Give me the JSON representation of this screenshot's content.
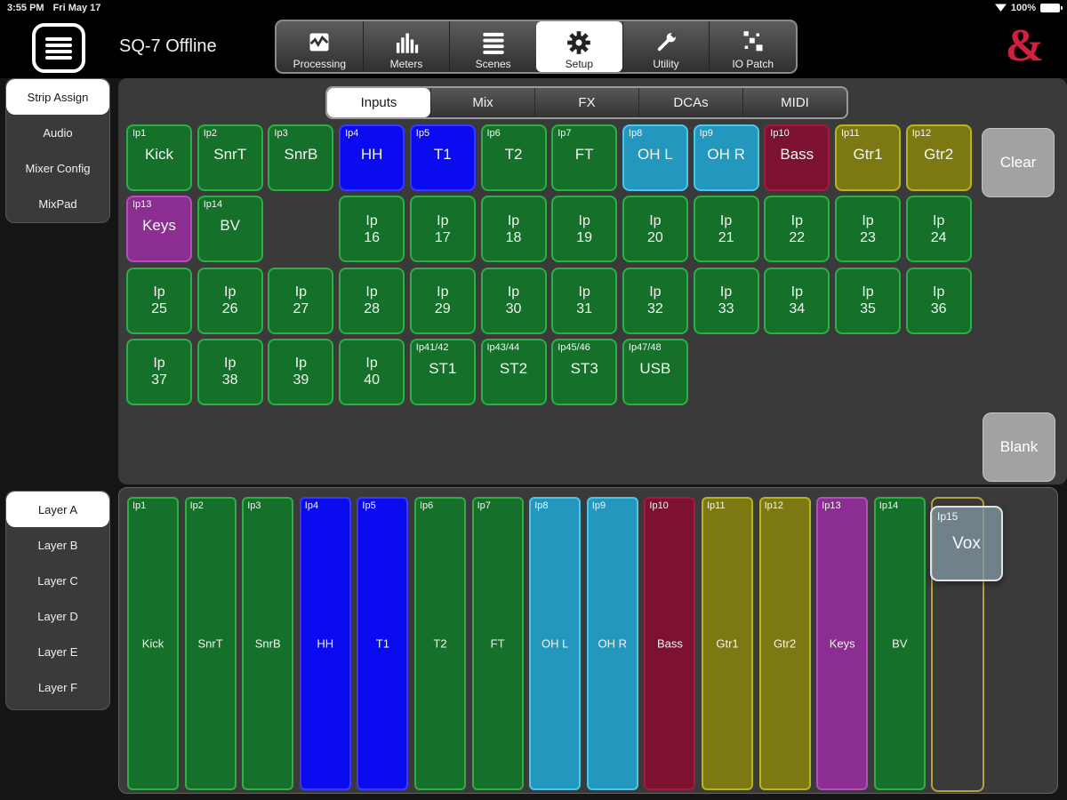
{
  "status_bar": {
    "time": "3:55 PM",
    "date": "Fri May 17",
    "battery": "100%"
  },
  "header": {
    "title": "SQ-7 Offline",
    "logo": "&"
  },
  "nav": {
    "items": [
      {
        "label": "Processing",
        "icon": "processing-icon",
        "selected": false
      },
      {
        "label": "Meters",
        "icon": "meters-icon",
        "selected": false
      },
      {
        "label": "Scenes",
        "icon": "scenes-icon",
        "selected": false
      },
      {
        "label": "Setup",
        "icon": "gear-icon",
        "selected": true
      },
      {
        "label": "Utility",
        "icon": "wrench-icon",
        "selected": false
      },
      {
        "label": "IO Patch",
        "icon": "io-patch-icon",
        "selected": false
      }
    ]
  },
  "sidebar_top": {
    "items": [
      {
        "label": "Strip Assign",
        "selected": true
      },
      {
        "label": "Audio",
        "selected": false
      },
      {
        "label": "Mixer Config",
        "selected": false
      },
      {
        "label": "MixPad",
        "selected": false
      }
    ]
  },
  "tabs": {
    "items": [
      {
        "label": "Inputs",
        "selected": true
      },
      {
        "label": "Mix",
        "selected": false
      },
      {
        "label": "FX",
        "selected": false
      },
      {
        "label": "DCAs",
        "selected": false
      },
      {
        "label": "MIDI",
        "selected": false
      }
    ]
  },
  "channel_grid": {
    "clear_label": "Clear",
    "blank_label": "Blank",
    "buttons": [
      {
        "corner": "Ip1",
        "name": "Kick",
        "color": "green",
        "row": 1,
        "col": 1
      },
      {
        "corner": "Ip2",
        "name": "SnrT",
        "color": "green",
        "row": 1,
        "col": 2
      },
      {
        "corner": "Ip3",
        "name": "SnrB",
        "color": "green",
        "row": 1,
        "col": 3
      },
      {
        "corner": "Ip4",
        "name": "HH",
        "color": "blue",
        "row": 1,
        "col": 4
      },
      {
        "corner": "Ip5",
        "name": "T1",
        "color": "blue",
        "row": 1,
        "col": 5
      },
      {
        "corner": "Ip6",
        "name": "T2",
        "color": "green",
        "row": 1,
        "col": 6
      },
      {
        "corner": "Ip7",
        "name": "FT",
        "color": "green",
        "row": 1,
        "col": 7
      },
      {
        "corner": "Ip8",
        "name": "OH L",
        "color": "cyan",
        "row": 1,
        "col": 8
      },
      {
        "corner": "Ip9",
        "name": "OH R",
        "color": "cyan",
        "row": 1,
        "col": 9
      },
      {
        "corner": "Ip10",
        "name": "Bass",
        "color": "maroon",
        "row": 1,
        "col": 10
      },
      {
        "corner": "Ip11",
        "name": "Gtr1",
        "color": "olive",
        "row": 1,
        "col": 11
      },
      {
        "corner": "Ip12",
        "name": "Gtr2",
        "color": "olive",
        "row": 1,
        "col": 12
      },
      {
        "corner": "Ip13",
        "name": "Keys",
        "color": "purple",
        "row": 2,
        "col": 1
      },
      {
        "corner": "Ip14",
        "name": "BV",
        "color": "green",
        "row": 2,
        "col": 2
      },
      {
        "lines": [
          "Ip",
          "16"
        ],
        "color": "green",
        "row": 2,
        "col": 4
      },
      {
        "lines": [
          "Ip",
          "17"
        ],
        "color": "green",
        "row": 2,
        "col": 5
      },
      {
        "lines": [
          "Ip",
          "18"
        ],
        "color": "green",
        "row": 2,
        "col": 6
      },
      {
        "lines": [
          "Ip",
          "19"
        ],
        "color": "green",
        "row": 2,
        "col": 7
      },
      {
        "lines": [
          "Ip",
          "20"
        ],
        "color": "green",
        "row": 2,
        "col": 8
      },
      {
        "lines": [
          "Ip",
          "21"
        ],
        "color": "green",
        "row": 2,
        "col": 9
      },
      {
        "lines": [
          "Ip",
          "22"
        ],
        "color": "green",
        "row": 2,
        "col": 10
      },
      {
        "lines": [
          "Ip",
          "23"
        ],
        "color": "green",
        "row": 2,
        "col": 11
      },
      {
        "lines": [
          "Ip",
          "24"
        ],
        "color": "green",
        "row": 2,
        "col": 12
      },
      {
        "lines": [
          "Ip",
          "25"
        ],
        "color": "green",
        "row": 3,
        "col": 1
      },
      {
        "lines": [
          "Ip",
          "26"
        ],
        "color": "green",
        "row": 3,
        "col": 2
      },
      {
        "lines": [
          "Ip",
          "27"
        ],
        "color": "green",
        "row": 3,
        "col": 3
      },
      {
        "lines": [
          "Ip",
          "28"
        ],
        "color": "green",
        "row": 3,
        "col": 4
      },
      {
        "lines": [
          "Ip",
          "29"
        ],
        "color": "green",
        "row": 3,
        "col": 5
      },
      {
        "lines": [
          "Ip",
          "30"
        ],
        "color": "green",
        "row": 3,
        "col": 6
      },
      {
        "lines": [
          "Ip",
          "31"
        ],
        "color": "green",
        "row": 3,
        "col": 7
      },
      {
        "lines": [
          "Ip",
          "32"
        ],
        "color": "green",
        "row": 3,
        "col": 8
      },
      {
        "lines": [
          "Ip",
          "33"
        ],
        "color": "green",
        "row": 3,
        "col": 9
      },
      {
        "lines": [
          "Ip",
          "34"
        ],
        "color": "green",
        "row": 3,
        "col": 10
      },
      {
        "lines": [
          "Ip",
          "35"
        ],
        "color": "green",
        "row": 3,
        "col": 11
      },
      {
        "lines": [
          "Ip",
          "36"
        ],
        "color": "green",
        "row": 3,
        "col": 12
      },
      {
        "lines": [
          "Ip",
          "37"
        ],
        "color": "green",
        "row": 4,
        "col": 1
      },
      {
        "lines": [
          "Ip",
          "38"
        ],
        "color": "green",
        "row": 4,
        "col": 2
      },
      {
        "lines": [
          "Ip",
          "39"
        ],
        "color": "green",
        "row": 4,
        "col": 3
      },
      {
        "lines": [
          "Ip",
          "40"
        ],
        "color": "green",
        "row": 4,
        "col": 4
      },
      {
        "corner": "Ip41/42",
        "name": "ST1",
        "color": "green",
        "row": 4,
        "col": 5
      },
      {
        "corner": "Ip43/44",
        "name": "ST2",
        "color": "green",
        "row": 4,
        "col": 6
      },
      {
        "corner": "Ip45/46",
        "name": "ST3",
        "color": "green",
        "row": 4,
        "col": 7
      },
      {
        "corner": "Ip47/48",
        "name": "USB",
        "color": "green",
        "row": 4,
        "col": 8
      }
    ]
  },
  "layers": {
    "items": [
      {
        "label": "Layer A",
        "selected": true
      },
      {
        "label": "Layer B",
        "selected": false
      },
      {
        "label": "Layer C",
        "selected": false
      },
      {
        "label": "Layer D",
        "selected": false
      },
      {
        "label": "Layer E",
        "selected": false
      },
      {
        "label": "Layer F",
        "selected": false
      }
    ]
  },
  "strips": {
    "items": [
      {
        "corner": "Ip1",
        "name": "Kick",
        "color": "green"
      },
      {
        "corner": "Ip2",
        "name": "SnrT",
        "color": "green"
      },
      {
        "corner": "Ip3",
        "name": "SnrB",
        "color": "green"
      },
      {
        "corner": "Ip4",
        "name": "HH",
        "color": "blue"
      },
      {
        "corner": "Ip5",
        "name": "T1",
        "color": "blue"
      },
      {
        "corner": "Ip6",
        "name": "T2",
        "color": "green"
      },
      {
        "corner": "Ip7",
        "name": "FT",
        "color": "green"
      },
      {
        "corner": "Ip8",
        "name": "OH L",
        "color": "cyan"
      },
      {
        "corner": "Ip9",
        "name": "OH R",
        "color": "cyan"
      },
      {
        "corner": "Ip10",
        "name": "Bass",
        "color": "maroon"
      },
      {
        "corner": "Ip11",
        "name": "Gtr1",
        "color": "olive"
      },
      {
        "corner": "Ip12",
        "name": "Gtr2",
        "color": "olive"
      },
      {
        "corner": "Ip13",
        "name": "Keys",
        "color": "purple"
      },
      {
        "corner": "Ip14",
        "name": "BV",
        "color": "green"
      }
    ],
    "drag_ghost": {
      "corner": "Ip15",
      "name": "Vox"
    }
  },
  "colors": {
    "green": {
      "fill": "#15702a",
      "border": "#2fae47"
    },
    "blue": {
      "fill": "#0b0bef",
      "border": "#3a3aff"
    },
    "cyan": {
      "fill": "#2397be",
      "border": "#4cc7e8"
    },
    "maroon": {
      "fill": "#7c1230",
      "border": "#a51a3e"
    },
    "olive": {
      "fill": "#7d7912",
      "border": "#b8b320"
    },
    "purple": {
      "fill": "#8c2d92",
      "border": "#b050b8"
    },
    "empty_slot_border": "#b1a43e",
    "accent_red": "#cf2040"
  }
}
